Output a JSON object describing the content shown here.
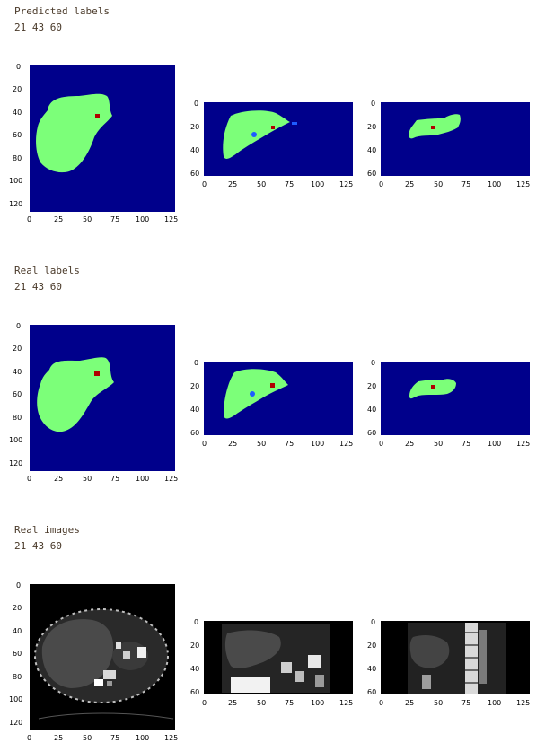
{
  "sections": [
    {
      "title": "Predicted labels",
      "coords": "21 43 60"
    },
    {
      "title": "Real labels",
      "coords": "21 43 60"
    },
    {
      "title": "Real images",
      "coords": "21 43 60"
    }
  ],
  "axis_ticks": {
    "x": [
      "0",
      "25",
      "50",
      "75",
      "100",
      "125"
    ],
    "y_large": [
      "0",
      "20",
      "40",
      "60",
      "80",
      "100",
      "120"
    ],
    "y_small": [
      "0",
      "20",
      "40",
      "60"
    ]
  },
  "colors": {
    "background_label": "#00008b",
    "liver_label": "#7cff79",
    "tumor_label": "#b00000",
    "vessel_label": "#1e5cff",
    "ct_background": "#000000"
  }
}
